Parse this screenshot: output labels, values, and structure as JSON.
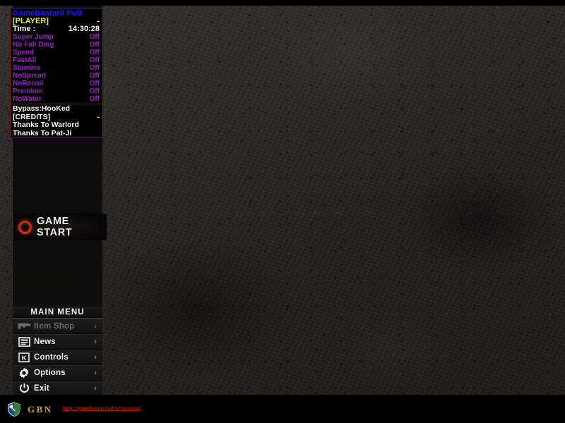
{
  "cheat_panel": {
    "title": "GameBastar0 PuB",
    "border_color": "#8e1414",
    "title_color": "#1c1cd8",
    "option_color": "#9b1fc4",
    "status_rows": [
      {
        "label": "[PLAYER]",
        "value": "-"
      },
      {
        "label": "Time :",
        "value": "14:30:28"
      }
    ],
    "options": [
      {
        "label": "Super Jump",
        "value": "Off"
      },
      {
        "label": "No Fall Dmg",
        "value": "Off"
      },
      {
        "label": "Speed",
        "value": "Off"
      },
      {
        "label": "FastAll",
        "value": "Off"
      },
      {
        "label": "Stamina",
        "value": "Off"
      },
      {
        "label": "NoSpread",
        "value": "Off"
      },
      {
        "label": "NoRecoil",
        "value": "Off"
      },
      {
        "label": "Premium",
        "value": "Off"
      },
      {
        "label": "NoWater",
        "value": "Off"
      }
    ],
    "credits": [
      {
        "label": "Bypass:HooKed",
        "value": ""
      },
      {
        "label": "[CREDITS]",
        "value": "-"
      },
      {
        "label": "Thanks To Warlord",
        "value": ""
      },
      {
        "label": "Thanks To Pat-Ji",
        "value": ""
      }
    ]
  },
  "game_start": {
    "label": "GAME START",
    "icon": "ring-icon"
  },
  "main_menu": {
    "header": "MAIN MENU",
    "chevron": "›",
    "items": [
      {
        "label": "Item Shop",
        "icon": "gun-icon",
        "disabled": true
      },
      {
        "label": "News",
        "icon": "news-icon",
        "disabled": false
      },
      {
        "label": "Controls",
        "icon": "keyboard-icon",
        "disabled": false
      },
      {
        "label": "Options",
        "icon": "gear-icon",
        "disabled": false
      },
      {
        "label": "Exit",
        "icon": "power-icon",
        "disabled": false
      }
    ]
  },
  "footer": {
    "brand": "GBN",
    "brand_icon": "shield-icon",
    "url": "http://gamebastard.altervista.org/",
    "url_color": "#b01a12",
    "brand_color": "#c9a227"
  }
}
